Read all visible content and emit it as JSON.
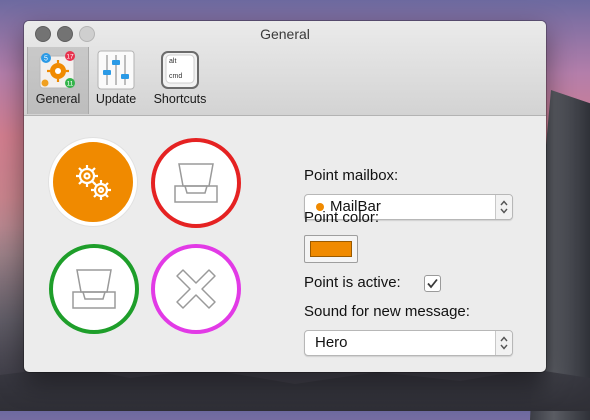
{
  "window": {
    "title": "General",
    "toolbar": [
      {
        "label": "General",
        "icon": "general-settings-icon",
        "selected": true
      },
      {
        "label": "Update",
        "icon": "sliders-icon",
        "selected": false
      },
      {
        "label": "Shortcuts",
        "icon": "keyboard-key-icon",
        "selected": false
      }
    ],
    "general_icon_badges": [
      "5",
      "17",
      "11"
    ],
    "shortcut_key": {
      "top": "alt",
      "bottom": "cmd"
    }
  },
  "settings": {
    "point_mailbox_label": "Point mailbox:",
    "point_mailbox_value": "MailBar",
    "point_color_label": "Point color:",
    "point_color_value": "#F08A00",
    "point_active_label": "Point is active:",
    "point_active_checked": true,
    "sound_label": "Sound for new message:",
    "sound_value": "Hero"
  },
  "circles": [
    {
      "name": "settings",
      "ring": "#FFFFFF",
      "fill": "#F08A00",
      "icon": "gears-icon"
    },
    {
      "name": "inbox-red",
      "ring": "#E52222",
      "fill": "#FFFFFF",
      "icon": "inbox-tray-icon"
    },
    {
      "name": "inbox-green",
      "ring": "#1E9E2A",
      "fill": "#FFFFFF",
      "icon": "inbox-tray-icon"
    },
    {
      "name": "close",
      "ring": "#E23AE6",
      "fill": "#FFFFFF",
      "icon": "close-x-icon"
    }
  ]
}
